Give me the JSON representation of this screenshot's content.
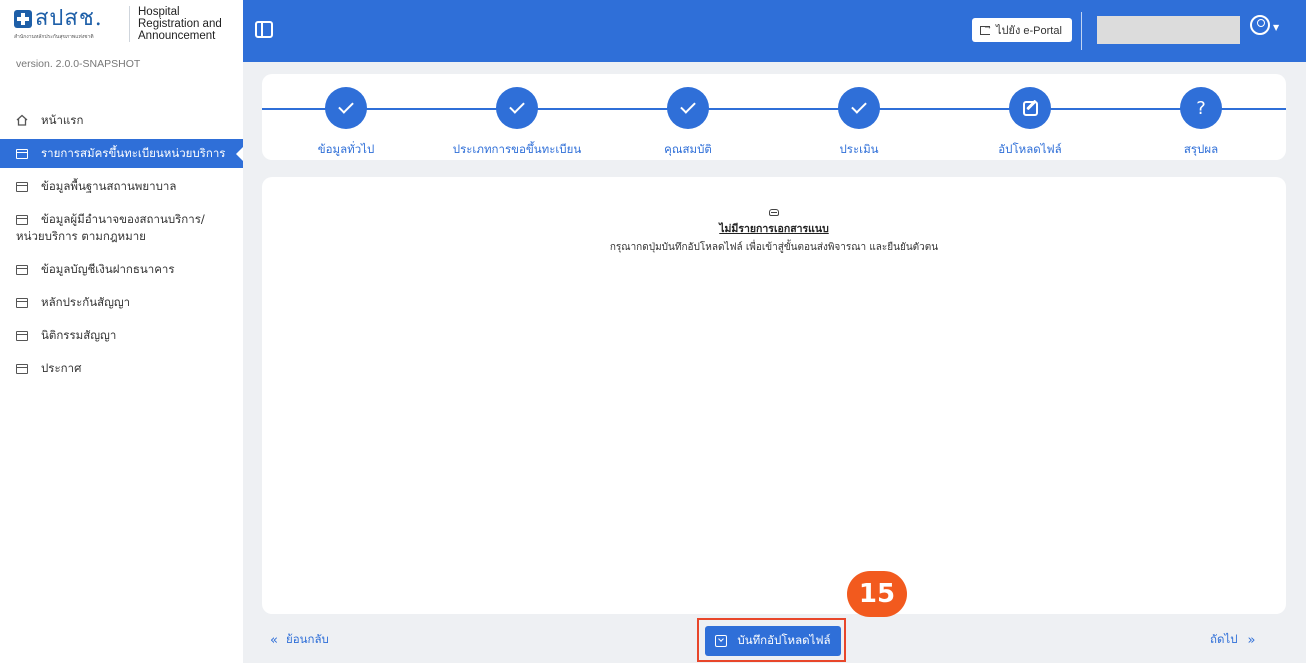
{
  "brand": {
    "logo_thai": "สปสช.",
    "logo_sub": "สำนักงานหลักประกันสุขภาพแห่งชาติ",
    "app_title_line1": "Hospital",
    "app_title_line2": "Registration and",
    "app_title_line3": "Announcement",
    "version": "version. 2.0.0-SNAPSHOT"
  },
  "sidebar": {
    "items": [
      {
        "label": "หน้าแรก",
        "icon": "home-icon"
      },
      {
        "label": "รายการสมัครขึ้นทะเบียนหน่วยบริการ",
        "icon": "list-icon",
        "active": true
      },
      {
        "label": "ข้อมูลพื้นฐานสถานพยาบาล",
        "icon": "list-icon"
      },
      {
        "label": "ข้อมูลผู้มีอำนาจของสถานบริการ/หน่วยบริการ ตามกฎหมาย",
        "icon": "list-icon"
      },
      {
        "label": "ข้อมูลบัญชีเงินฝากธนาคาร",
        "icon": "list-icon"
      },
      {
        "label": "หลักประกันสัญญา",
        "icon": "list-icon"
      },
      {
        "label": "นิติกรรมสัญญา",
        "icon": "list-icon"
      },
      {
        "label": "ประกาศ",
        "icon": "list-icon"
      }
    ]
  },
  "header": {
    "portal_label": "ไปยัง e-Portal"
  },
  "stepper": {
    "steps": [
      {
        "label": "ข้อมูลทั่วไป",
        "state": "done"
      },
      {
        "label": "ประเภทการขอขึ้นทะเบียน",
        "state": "done"
      },
      {
        "label": "คุณสมบัติ",
        "state": "done"
      },
      {
        "label": "ประเมิน",
        "state": "done"
      },
      {
        "label": "อัปโหลดไฟล์",
        "state": "current"
      },
      {
        "label": "สรุปผล",
        "state": "pending",
        "symbol": "?"
      }
    ]
  },
  "content": {
    "empty_title": "ไม่มีรายการเอกสารแนบ",
    "empty_desc": "กรุณากดปุ่มบันทึกอัปโหลดไฟล์ เพื่อเข้าสู่ขั้นตอนส่งพิจารณา และยืนยันตัวตน"
  },
  "footer": {
    "back_label": "ย้อนกลับ",
    "save_label": "บันทึกอัปโหลดไฟล์",
    "next_label": "ถัดไป"
  },
  "annotation": {
    "badge": "15",
    "color": "#f25a1e"
  },
  "colors": {
    "primary": "#2f6fd8",
    "background": "#eef0f3",
    "highlight": "#e8462a"
  }
}
